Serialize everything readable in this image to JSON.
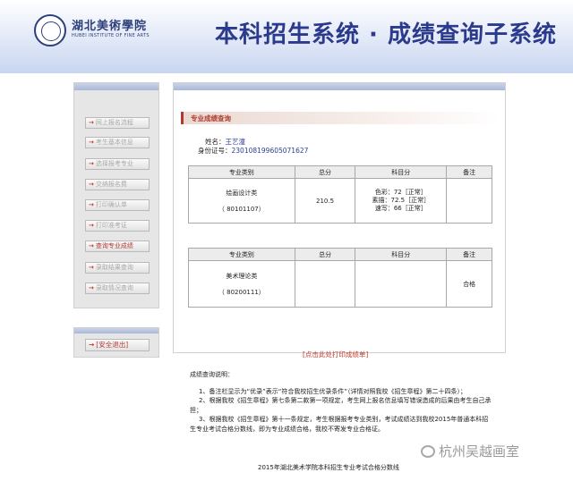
{
  "header": {
    "school_name": "湖北美術學院",
    "school_en": "HUBEI INSTITUTE OF FINE ARTS",
    "system_title": "本科招生系统 · 成绩查询子系统"
  },
  "sidebar": {
    "items": [
      {
        "label": "网上报名流程"
      },
      {
        "label": "考生基本信息"
      },
      {
        "label": "选择报考专业"
      },
      {
        "label": "交纳报名费"
      },
      {
        "label": "打印确认单"
      },
      {
        "label": "打印准考证"
      },
      {
        "label": "查询专业成绩"
      },
      {
        "label": "录取结果查询"
      },
      {
        "label": "录取情况查询"
      }
    ],
    "logout": "[安全退出]"
  },
  "main": {
    "section_title": "专业成绩查询",
    "name_label": "姓名：",
    "name_value": "王艺潼",
    "id_label": "身份证号：",
    "id_value": "230108199605071627",
    "table_headers": [
      "专业类别",
      "总分",
      "科目分",
      "备注"
    ],
    "table1": {
      "major": "绘画设计类",
      "code": "（ 80101107）",
      "total": "210.5",
      "subjects": [
        "色彩：72［正常］",
        "素描：72.5［正常］",
        "速写：66［正常］"
      ],
      "note": ""
    },
    "table2": {
      "major": "美术理论类",
      "code": "（ 80200111）",
      "total": "",
      "subjects": [],
      "note": "合格"
    },
    "print_link": "[点击此处打印成绩单]"
  },
  "notes": {
    "title": "成绩查询说明：",
    "items": [
      "1、备注栏显示为“优录”表示“符合我校招生优录条件”（详情对照我校《招生章程》第二十四条）；",
      "2、根据我校《招生章程》第七条第二款第一项规定，考生网上报名信息填写错误造成的后果由考生自己承担；",
      "3、根据我校《招生章程》第十一条规定，考生根据报考专业类别，考试成绩达到我校2015年普通本科招生专业考试合格分数线，即为专业成绩合格，我校不寄发专业合格证。"
    ]
  },
  "footer": "2015年湖北美术学院本科招生专业考试合格分数线",
  "watermark": "杭州吴越画室"
}
